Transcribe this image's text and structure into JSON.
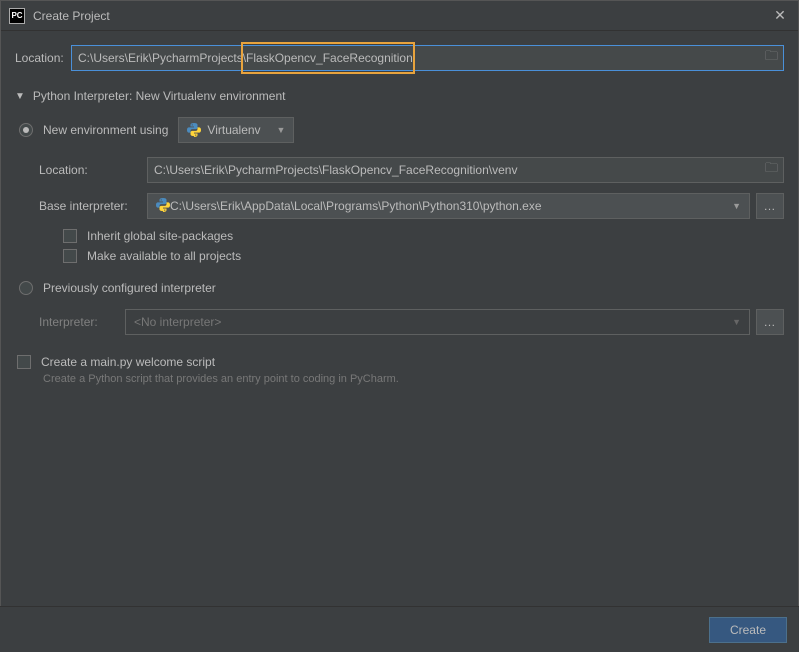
{
  "titlebar": {
    "app_badge": "PC",
    "title": "Create Project"
  },
  "location": {
    "label": "Location:",
    "value": "C:\\Users\\Erik\\PycharmProjects\\FlaskOpencv_FaceRecognition"
  },
  "interpreter_section": {
    "header": "Python Interpreter: New Virtualenv environment",
    "new_env": {
      "radio_label": "New environment using",
      "tool": "Virtualenv",
      "location_label": "Location:",
      "location_value": "C:\\Users\\Erik\\PycharmProjects\\FlaskOpencv_FaceRecognition\\venv",
      "base_label": "Base interpreter:",
      "base_value": "C:\\Users\\Erik\\AppData\\Local\\Programs\\Python\\Python310\\python.exe",
      "inherit_label": "Inherit global site-packages",
      "make_available_label": "Make available to all projects"
    },
    "prev_env": {
      "radio_label": "Previously configured interpreter",
      "interp_label": "Interpreter:",
      "interp_value": "<No interpreter>"
    }
  },
  "welcome": {
    "label": "Create a main.py welcome script",
    "desc": "Create a Python script that provides an entry point to coding in PyCharm."
  },
  "footer": {
    "create": "Create"
  }
}
